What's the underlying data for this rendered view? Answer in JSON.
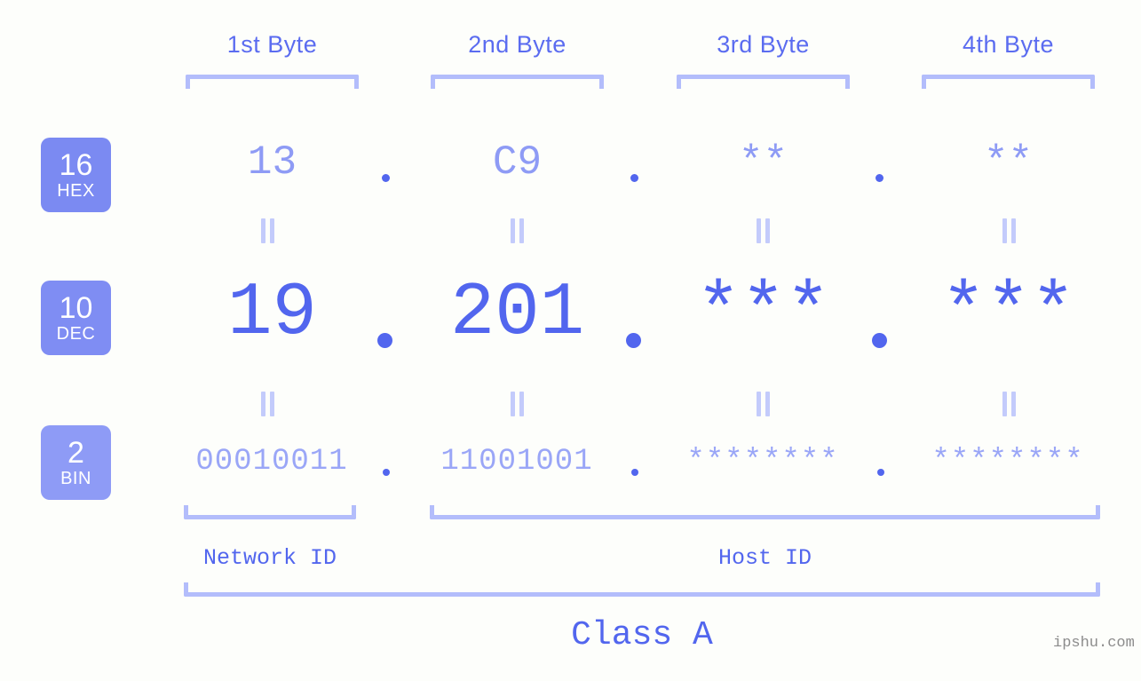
{
  "background_color": "#fdfefb",
  "colors": {
    "accent_strong": "#5266ee",
    "accent_medium": "#8e9bf5",
    "accent_light": "#b3bdfb",
    "badge_hex": "#7b8af2",
    "badge_dec": "#7f8df3",
    "badge_bin": "#8e9bf6",
    "watermark": "#8c8c8c"
  },
  "byte_headers": [
    {
      "label": "1st Byte"
    },
    {
      "label": "2nd Byte"
    },
    {
      "label": "3rd Byte"
    },
    {
      "label": "4th Byte"
    }
  ],
  "bases": [
    {
      "number": "16",
      "name": "HEX"
    },
    {
      "number": "10",
      "name": "DEC"
    },
    {
      "number": "2",
      "name": "BIN"
    }
  ],
  "rows": {
    "hex": {
      "values": [
        "13",
        "C9",
        "**",
        "**"
      ]
    },
    "dec": {
      "values": [
        "19",
        "201",
        "***",
        "***"
      ]
    },
    "bin": {
      "values": [
        "00010011",
        "11001001",
        "********",
        "********"
      ]
    }
  },
  "separator": ".",
  "equals_connector": "||",
  "sections": [
    {
      "label": "Network ID"
    },
    {
      "label": "Host ID"
    }
  ],
  "class": {
    "label": "Class A"
  },
  "watermark": {
    "text": "ipshu.com"
  }
}
